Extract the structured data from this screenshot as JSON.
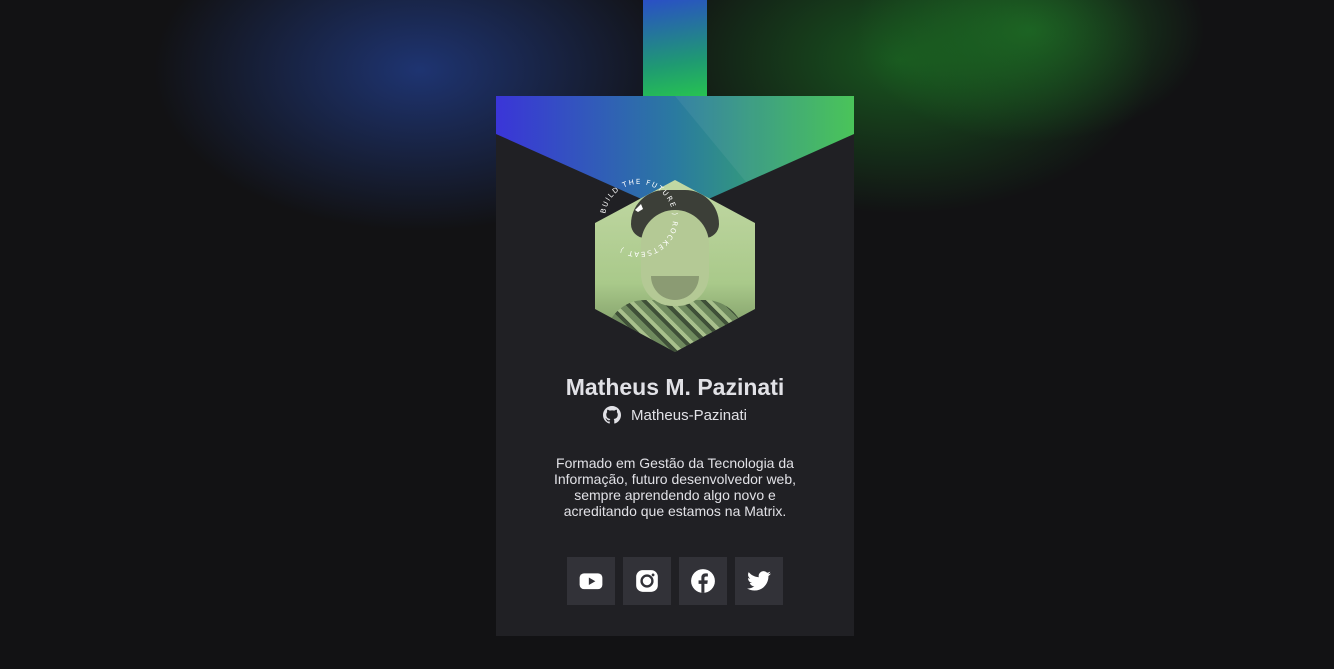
{
  "profile": {
    "name": "Matheus M. Pazinati",
    "github_user": "Matheus-Pazinati",
    "bio": "Formado em Gestão da Tecnologia da Informação, futuro desenvolvedor web, sempre aprendendo algo novo e acreditando que estamos na Matrix.",
    "badge_ring_text": "BUILD THE FUTURE · ROCKETSEAT"
  },
  "socials": [
    {
      "name": "youtube",
      "icon": "youtube-icon"
    },
    {
      "name": "instagram",
      "icon": "instagram-icon"
    },
    {
      "name": "facebook",
      "icon": "facebook-icon"
    },
    {
      "name": "twitter",
      "icon": "twitter-icon"
    }
  ],
  "colors": {
    "background": "#121214",
    "card": "#202024",
    "button": "#323238",
    "text": "#e1e1e6",
    "gradient_start": "#3a35d8",
    "gradient_end": "#3fc14f"
  }
}
